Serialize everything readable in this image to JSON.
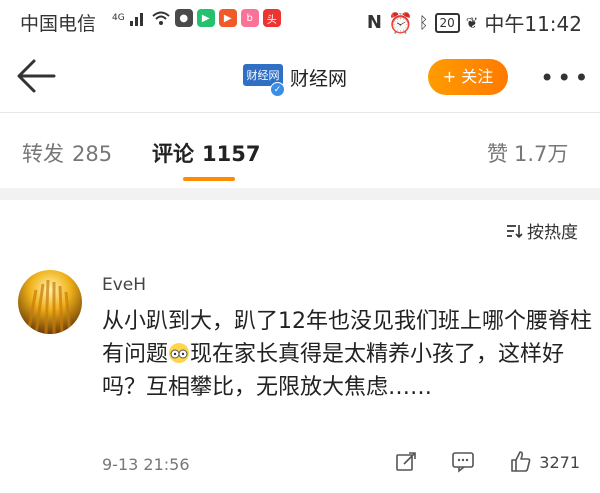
{
  "status_bar": {
    "carrier": "中国电信",
    "network": "4G",
    "time": "中午11:42",
    "battery": "20"
  },
  "header": {
    "logo_text": "财经网",
    "account_name": "财经网",
    "follow_label": "+ 关注"
  },
  "tabs": [
    {
      "label": "转发",
      "count": "285"
    },
    {
      "label": "评论",
      "count": "1157"
    },
    {
      "label": "赞",
      "count": "1.7万"
    }
  ],
  "sort_label": "按热度",
  "comment": {
    "username": "EveH",
    "text_part1": "从小趴到大，趴了12年也没见我们班上哪个腰脊柱有问题",
    "text_part2": "现在家长真得是太精养小孩了，这样好吗？互相攀比，无限放大焦虑……",
    "timestamp": "9-13 21:56",
    "likes": "3271"
  },
  "colors": {
    "accent_orange": "#ff8c00",
    "verified_blue": "#3a8ee6"
  },
  "icons": [
    "back-arrow-icon",
    "verified-icon",
    "more-icon",
    "sort-icon",
    "share-icon",
    "comment-icon",
    "like-icon",
    "emoji-icon"
  ]
}
